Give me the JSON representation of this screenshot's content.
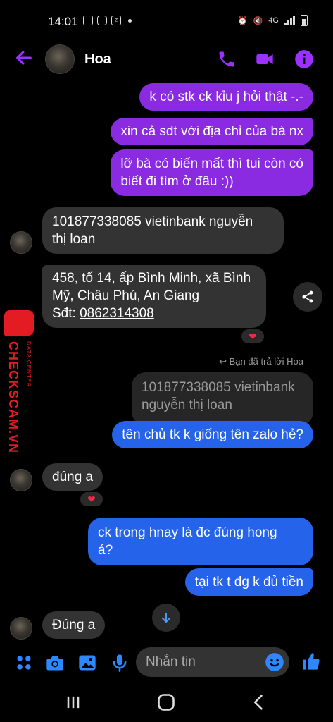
{
  "status": {
    "time": "14:01",
    "network": "4G"
  },
  "header": {
    "name": "Hoa"
  },
  "colors": {
    "accent": "#8a2be2",
    "bubble_blue": "#2563eb",
    "bubble_dark": "#333333",
    "watermark": "#e31b23"
  },
  "messages": {
    "m1": "k có stk ck kỉu j hỏi thật -.-",
    "m2": "xin cả sdt với địa chỉ của bà nx",
    "m3_line1": "lỡ bà có biến mất thì tui còn có",
    "m3_line2": "biết đi tìm ở đâu :))",
    "m4_line1": "101877338085 vietinbank nguyễn",
    "m4_line2": "thị loan",
    "m5_line1": "458, tổ 14, ấp Bình Minh, xã Bình",
    "m5_line2": "Mỹ, Châu Phú, An Giang",
    "m5_line3_prefix": "Sđt: ",
    "m5_phone": "0862314308",
    "reply_label": "Bạn đã trả lời Hoa",
    "quoted_line1": "101877338085 vietinbank",
    "quoted_line2": "nguyễn thị loan",
    "m6": "tên chủ tk k giống tên zalo hẻ?",
    "m7": "đúng a",
    "m8_line1": "ck trong hnay là đc đúng hong",
    "m8_line2": "á?",
    "m9": "tại tk t đg k đủ tiền",
    "m10": "Đúng a"
  },
  "reactions": {
    "r1": "❤",
    "r2": "❤"
  },
  "composer": {
    "placeholder": "Nhắn tin"
  },
  "watermark": {
    "brand": "CHECKSCAM.VN",
    "sub": "DATA CENTER"
  },
  "icons": [
    "back-arrow-icon",
    "phone-icon",
    "video-icon",
    "info-icon",
    "share-icon",
    "reply-icon",
    "chevron-down-icon",
    "apps-icon",
    "camera-icon",
    "gallery-icon",
    "mic-icon",
    "emoji-icon",
    "like-icon",
    "recent-apps-icon",
    "home-icon",
    "back-nav-icon"
  ]
}
